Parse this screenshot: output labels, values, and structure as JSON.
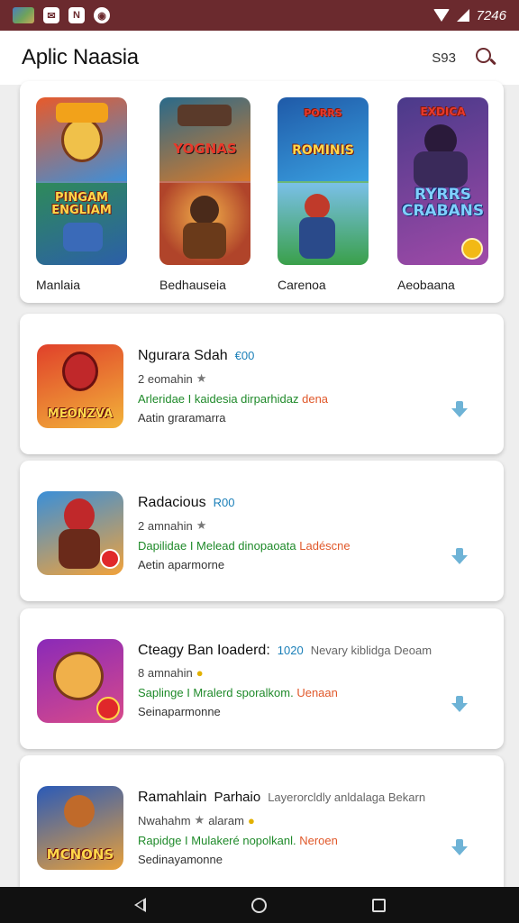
{
  "status_bar": {
    "time": "7246",
    "notification_icons": [
      "gallery-thumbnail-icon",
      "mail-icon",
      "news-icon",
      "messenger-icon"
    ],
    "icon_glyphs": [
      "",
      "✉",
      "N",
      "◉"
    ]
  },
  "app_bar": {
    "title": "Aplic Naasia",
    "code": "S93",
    "search_icon": "search-icon"
  },
  "featured": [
    {
      "label": "Manlaia",
      "top_text": "",
      "bottom_text": "PINGAM ENGLIAM",
      "top_colors": [
        "#e85a2a",
        "#3e8fd8"
      ],
      "bottom_colors": [
        "#2e8a5a",
        "#2c5fa8"
      ]
    },
    {
      "label": "Bedhauseia",
      "top_text": "YOGNAS",
      "bottom_text": "",
      "top_colors": [
        "#2a6a8a",
        "#d87a2a"
      ],
      "bottom_colors": [
        "#b0442a",
        "#e8903a"
      ]
    },
    {
      "label": "Carenoa",
      "top_text": "ROMINIS",
      "bottom_text": "",
      "top_colors": [
        "#1f5aa8",
        "#3aa0e0"
      ],
      "bottom_colors": [
        "#3aa04a",
        "#7ac0e8"
      ]
    },
    {
      "label": "Aeobaana",
      "top_text": "EXDICA",
      "bottom_text": "RYRRS CRABANS",
      "top_colors": [
        "#4a3a8a",
        "#a04aa8"
      ],
      "bottom_colors": [
        "#3a2a6a",
        "#8a4aa8"
      ]
    }
  ],
  "apps": [
    {
      "title": "Ngurara Sdah",
      "price": "€00",
      "extra": "",
      "rating": "2 eomahin",
      "star_gold": false,
      "desc": "Arleridae I kaidesia dirparhidaz",
      "desc_hl": "dena",
      "sub": "Aatin graramarra",
      "icon_text": "MEONZVA",
      "icon_colors": [
        "#e0402a",
        "#f2b33a"
      ]
    },
    {
      "title": "Radacious",
      "price": "R00",
      "extra": "",
      "rating": "2 amnahin",
      "star_gold": false,
      "desc": "Dapilidae I Melead dinopaoata",
      "desc_hl": "Ladéscne",
      "sub": "Aetin aparmorne",
      "icon_text": "",
      "icon_colors": [
        "#3a8fd8",
        "#f2a23a"
      ]
    },
    {
      "title": "Cteagy Ban Ioaderd:",
      "price": "1020",
      "extra": "Nevary kiblidga Deoam",
      "rating": "8 amnahin",
      "star_gold": true,
      "desc": "Saplinge I Mralerd sporalkom.",
      "desc_hl": "Uenaan",
      "sub": "Seinaparmonne",
      "icon_text": "",
      "icon_colors": [
        "#8a2ab8",
        "#d84a8a"
      ]
    },
    {
      "title": "Ramahlain",
      "price": "Parhaio",
      "extra": "Layerorcldly anldalaga Bekarn",
      "rating": "Nwahahm",
      "rating_suffix": "alaram",
      "star_gold": true,
      "desc": "Rapidge I Mulakeré nopolkanl.",
      "desc_hl": "Neroen",
      "sub": "Sedinayamonne",
      "icon_text": "MCNONS",
      "icon_colors": [
        "#2a5ab8",
        "#e8a03a"
      ]
    }
  ],
  "nav_bar": {
    "back": "back-icon",
    "home": "home-icon",
    "recents": "recents-icon"
  }
}
